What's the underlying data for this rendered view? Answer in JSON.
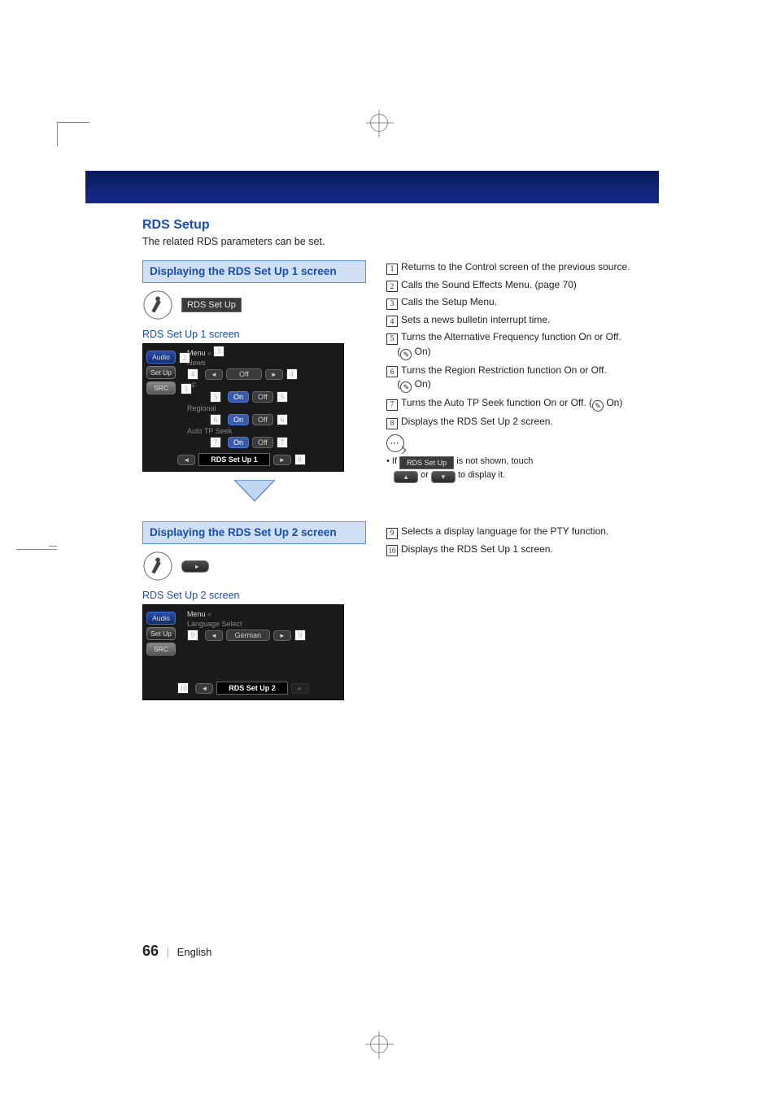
{
  "page": {
    "section_title": "RDS Setup",
    "section_sub": "The related RDS parameters can be set.",
    "page_number": "66",
    "page_lang": "English"
  },
  "panel1": {
    "title": "Displaying the RDS Set Up 1 screen",
    "pill_label": "RDS Set Up",
    "screen_caption": "RDS Set Up 1 screen",
    "sidebar": {
      "audio": "Audio",
      "setup": "Set Up",
      "src": "SRC"
    },
    "menu_label": "Menu",
    "rows": {
      "news": {
        "label": "News",
        "value": "Off"
      },
      "af": {
        "label": "AF",
        "on": "On",
        "off": "Off"
      },
      "regional": {
        "label": "Regional",
        "on": "On",
        "off": "Off"
      },
      "autotp": {
        "label": "Auto TP Seek",
        "on": "On",
        "off": "Off"
      }
    },
    "footer_label": "RDS Set Up 1",
    "callouts": [
      "1",
      "2",
      "3",
      "4",
      "5",
      "6",
      "7",
      "8"
    ]
  },
  "desc1": {
    "1": "Returns to the Control screen of the previous source.",
    "2": "Calls the Sound Effects Menu. (page 70)",
    "3": "Calls the Setup Menu.",
    "4": "Sets a news bulletin interrupt time.",
    "5": "Turns the Alternative Frequency function On or Off.",
    "5b": " On)",
    "6": "Turns the Region Restriction function On or Off.",
    "6b": " On)",
    "7": "Turns the Auto TP Seek function On or Off. (",
    "7b": " On)",
    "8": "Displays the RDS Set Up 2 screen."
  },
  "note": {
    "prefix": "If ",
    "pill": "RDS Set Up",
    "mid": " is not shown, touch ",
    "or": " or ",
    "end": " to display it."
  },
  "panel2": {
    "title": "Displaying the RDS Set Up 2 screen",
    "screen_caption": "RDS Set Up 2 screen",
    "sidebar": {
      "audio": "Audio",
      "setup": "Set Up",
      "src": "SRC"
    },
    "menu_label": "Menu",
    "row": {
      "label": "Language Select",
      "value": "German"
    },
    "footer_label": "RDS Set Up 2",
    "callouts": [
      "9",
      "10"
    ]
  },
  "desc2": {
    "9": "Selects a display language for the PTY function.",
    "10": "Displays the RDS Set Up 1 screen."
  }
}
